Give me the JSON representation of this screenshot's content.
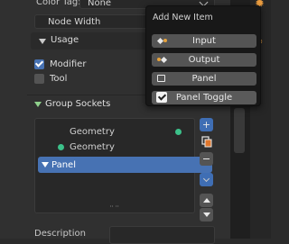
{
  "properties": {
    "color_tag_label": "Color Tag:",
    "color_tag_value": "None",
    "node_width_label": "Node Width",
    "usage_label": "Usage",
    "modifier_label": "Modifier",
    "modifier_checked": true,
    "tool_label": "Tool",
    "tool_checked": false,
    "group_sockets_label": "Group Sockets",
    "description_label": "Description"
  },
  "sockets": [
    {
      "name": "Geometry",
      "kind": "output"
    },
    {
      "name": "Geometry",
      "kind": "input"
    },
    {
      "name": "Panel",
      "kind": "panel",
      "selected": true
    }
  ],
  "side_buttons": [
    "add-icon",
    "duplicate-icon",
    "remove-icon",
    "menu-chevron-icon",
    "move-up-icon",
    "move-down-icon"
  ],
  "menu": {
    "title": "Add New Item",
    "items": [
      {
        "label": "Input",
        "icon": "input-socket-icon"
      },
      {
        "label": "Output",
        "icon": "output-socket-icon"
      },
      {
        "label": "Panel",
        "icon": "panel-icon"
      },
      {
        "label": "Panel Toggle",
        "icon": "checkbox-icon"
      }
    ]
  },
  "colors": {
    "accent": "#4772b3",
    "socket_geometry": "#3cc18a",
    "section_triangle": "#8fd18c"
  }
}
